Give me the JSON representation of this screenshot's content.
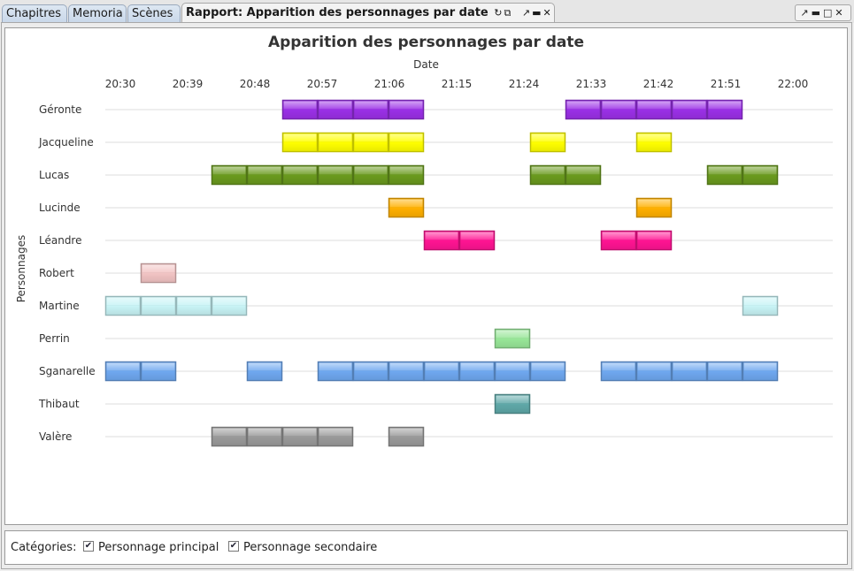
{
  "tabs": [
    {
      "label": "Chapitres"
    },
    {
      "label": "Memoria"
    },
    {
      "label": "Scènes"
    },
    {
      "label": "Rapport: Apparition des personnages par date"
    }
  ],
  "tab_icons": [
    "refresh-icon",
    "export-icon",
    "undock-icon",
    "minimize-icon",
    "close-icon"
  ],
  "window_controls": [
    "undock-icon",
    "minimize-icon",
    "maximize-icon",
    "close-icon"
  ],
  "legend": {
    "label": "Catégories:",
    "items": [
      {
        "label": "Personnage principal",
        "checked": true
      },
      {
        "label": "Personnage secondaire",
        "checked": true
      }
    ]
  },
  "chart_data": {
    "type": "gantt",
    "title": "Apparition des personnages par date",
    "xlabel": "Date",
    "ylabel": "Personnages",
    "x_ticks": [
      "20:30",
      "20:39",
      "20:48",
      "20:57",
      "21:06",
      "21:15",
      "21:24",
      "21:33",
      "21:42",
      "21:51",
      "22:00"
    ],
    "grid": "horizontal",
    "slot_minutes": 4.8,
    "start_time": "20:30",
    "series": [
      {
        "name": "Géronte",
        "color": "#9b30e6",
        "slots": [
          5,
          6,
          7,
          8,
          13,
          14,
          15,
          16,
          17
        ]
      },
      {
        "name": "Jacqueline",
        "color": "#ffff00",
        "slots": [
          5,
          6,
          7,
          8,
          12,
          15
        ]
      },
      {
        "name": "Lucas",
        "color": "#6a9a1e",
        "slots": [
          3,
          4,
          5,
          6,
          7,
          8,
          12,
          13,
          17,
          18
        ]
      },
      {
        "name": "Lucinde",
        "color": "#ffb000",
        "slots": [
          8,
          15
        ]
      },
      {
        "name": "Léandre",
        "color": "#ff1493",
        "slots": [
          9,
          10,
          14,
          15
        ]
      },
      {
        "name": "Robert",
        "color": "#f2c4c4",
        "slots": [
          1
        ]
      },
      {
        "name": "Martine",
        "color": "#c8f4f6",
        "slots": [
          0,
          1,
          2,
          3,
          18
        ]
      },
      {
        "name": "Perrin",
        "color": "#98e698",
        "slots": [
          11
        ]
      },
      {
        "name": "Sganarelle",
        "color": "#6fa8f0",
        "slots": [
          0,
          1,
          4,
          6,
          7,
          8,
          9,
          10,
          11,
          12,
          14,
          15,
          16,
          17,
          18
        ]
      },
      {
        "name": "Thibaut",
        "color": "#5fa8a8",
        "slots": [
          11
        ]
      },
      {
        "name": "Valère",
        "color": "#9a9a9a",
        "slots": [
          3,
          4,
          5,
          6,
          8
        ]
      }
    ]
  }
}
